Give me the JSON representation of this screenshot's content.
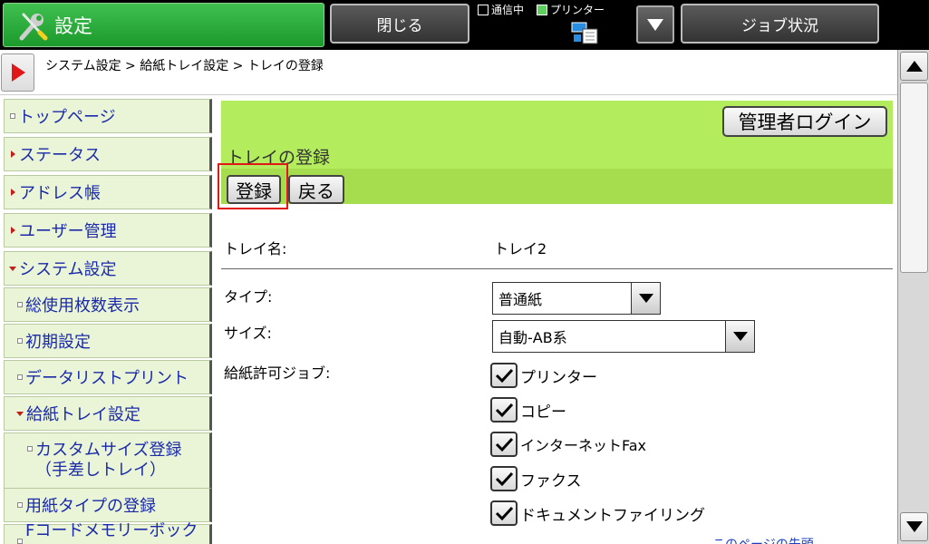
{
  "topbar": {
    "title": "設定",
    "close_label": "閉じる",
    "job_label": "ジョブ状況",
    "status_comm": "通信中",
    "status_printer": "プリンター",
    "icons": {
      "settings": "wrench-screwdriver-icon",
      "network": "network-printer-icon",
      "menu": "triangle-down-icon"
    }
  },
  "breadcrumb": {
    "text": "システム設定 > 給紙トレイ設定 > トレイの登録"
  },
  "sidebar": {
    "items": [
      {
        "label": "トップページ"
      },
      {
        "label": "ステータス"
      },
      {
        "label": "アドレス帳"
      },
      {
        "label": "ユーザー管理"
      },
      {
        "label": "システム設定"
      },
      {
        "label": "総使用枚数表示"
      },
      {
        "label": "初期設定"
      },
      {
        "label": "データリストプリント"
      },
      {
        "label": "給紙トレイ設定"
      },
      {
        "label_line1": "カスタムサイズ登録",
        "label_line2": "（手差しトレイ）"
      },
      {
        "label": "用紙タイプの登録"
      },
      {
        "label": "Fコードメモリーボックス"
      }
    ]
  },
  "main": {
    "admin_login": "管理者ログイン",
    "page_title": "トレイの登録",
    "register_label": "登録",
    "back_label": "戻る",
    "tray_name_label": "トレイ名:",
    "tray_name_value": "トレイ2",
    "type_label": "タイプ:",
    "type_value": "普通紙",
    "size_label": "サイズ:",
    "size_value": "自動-AB系",
    "jobs_label": "給紙許可ジョブ:",
    "jobs": [
      {
        "label": "プリンター",
        "checked": true
      },
      {
        "label": "コピー",
        "checked": true
      },
      {
        "label": "インターネットFax",
        "checked": true
      },
      {
        "label": "ファクス",
        "checked": true
      },
      {
        "label": "ドキュメントファイリング",
        "checked": true
      }
    ],
    "link_text": "このページの先頭"
  },
  "colors": {
    "title_green": "#1c9a2c",
    "header_green": "#b3ec5c",
    "action_green": "#a6dd4e",
    "sidebar_bg": "#eaf5d8",
    "sidebar_text": "#1a2aa8",
    "highlight_red": "#e01818"
  }
}
